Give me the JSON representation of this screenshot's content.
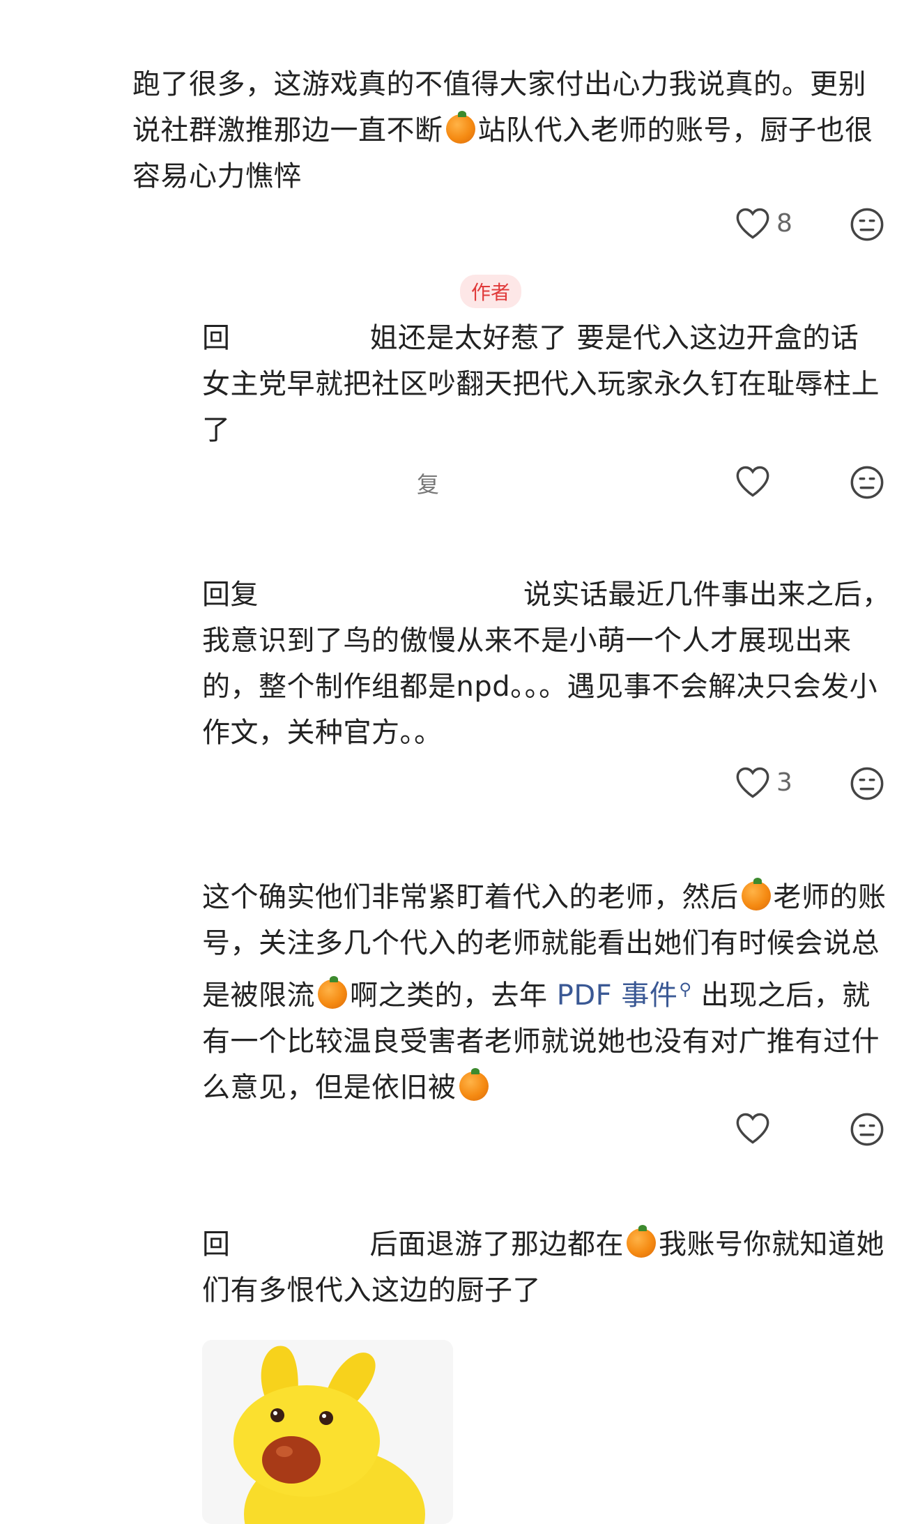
{
  "comments": [
    {
      "id": "c1",
      "parts": [
        "跑了很多，这游戏真的不值得大家付出心力我说真的。更别说社群激推那边一直不断",
        "站队代入老师的账号，厨子也很容易心力憔悴"
      ],
      "likes": "8"
    },
    {
      "id": "c2",
      "author_tag": "作者",
      "reply_prefix": "回",
      "parts": [
        "姐还是太好惹了 要是代入这边开盒的话 女主党早就把社区吵翻天把代入玩家永久钉在耻辱柱上了"
      ],
      "footer_fragment": "复",
      "likes": ""
    },
    {
      "id": "c3",
      "reply_prefix": "回复",
      "parts": [
        "说实话最近几件事出来之后，我意识到了鸟的傲慢从来不是小萌一个人才展现出来的，整个制作组都是npd。。。遇见事不会解决只会发小作文，关种官方。。"
      ],
      "likes": "3"
    },
    {
      "id": "c4",
      "parts": [
        "这个确实他们非常紧盯着代入的老师，然后",
        "老师的账号，关注多几个代入的老师就能看出她们有时候会说总是被限流",
        "啊之类的，去年 ",
        "PDF 事件",
        " 出现之后，就有一个比较温良受害者老师就说她也没有对广推有过什么意见，但是依旧被"
      ],
      "likes": ""
    },
    {
      "id": "c5",
      "reply_prefix": "回",
      "parts": [
        "后面退游了那边都在",
        "我账号你就知道她们有多恨代入这边的厨子了"
      ]
    }
  ],
  "colors": {
    "text": "#222222",
    "link": "#3a5894",
    "icon": "#444444",
    "orange": "#f58a12",
    "author_tag": "#e03a3a"
  },
  "icons": [
    "heart-icon",
    "neutral-face-icon",
    "orange-emoji-icon",
    "search-icon"
  ]
}
